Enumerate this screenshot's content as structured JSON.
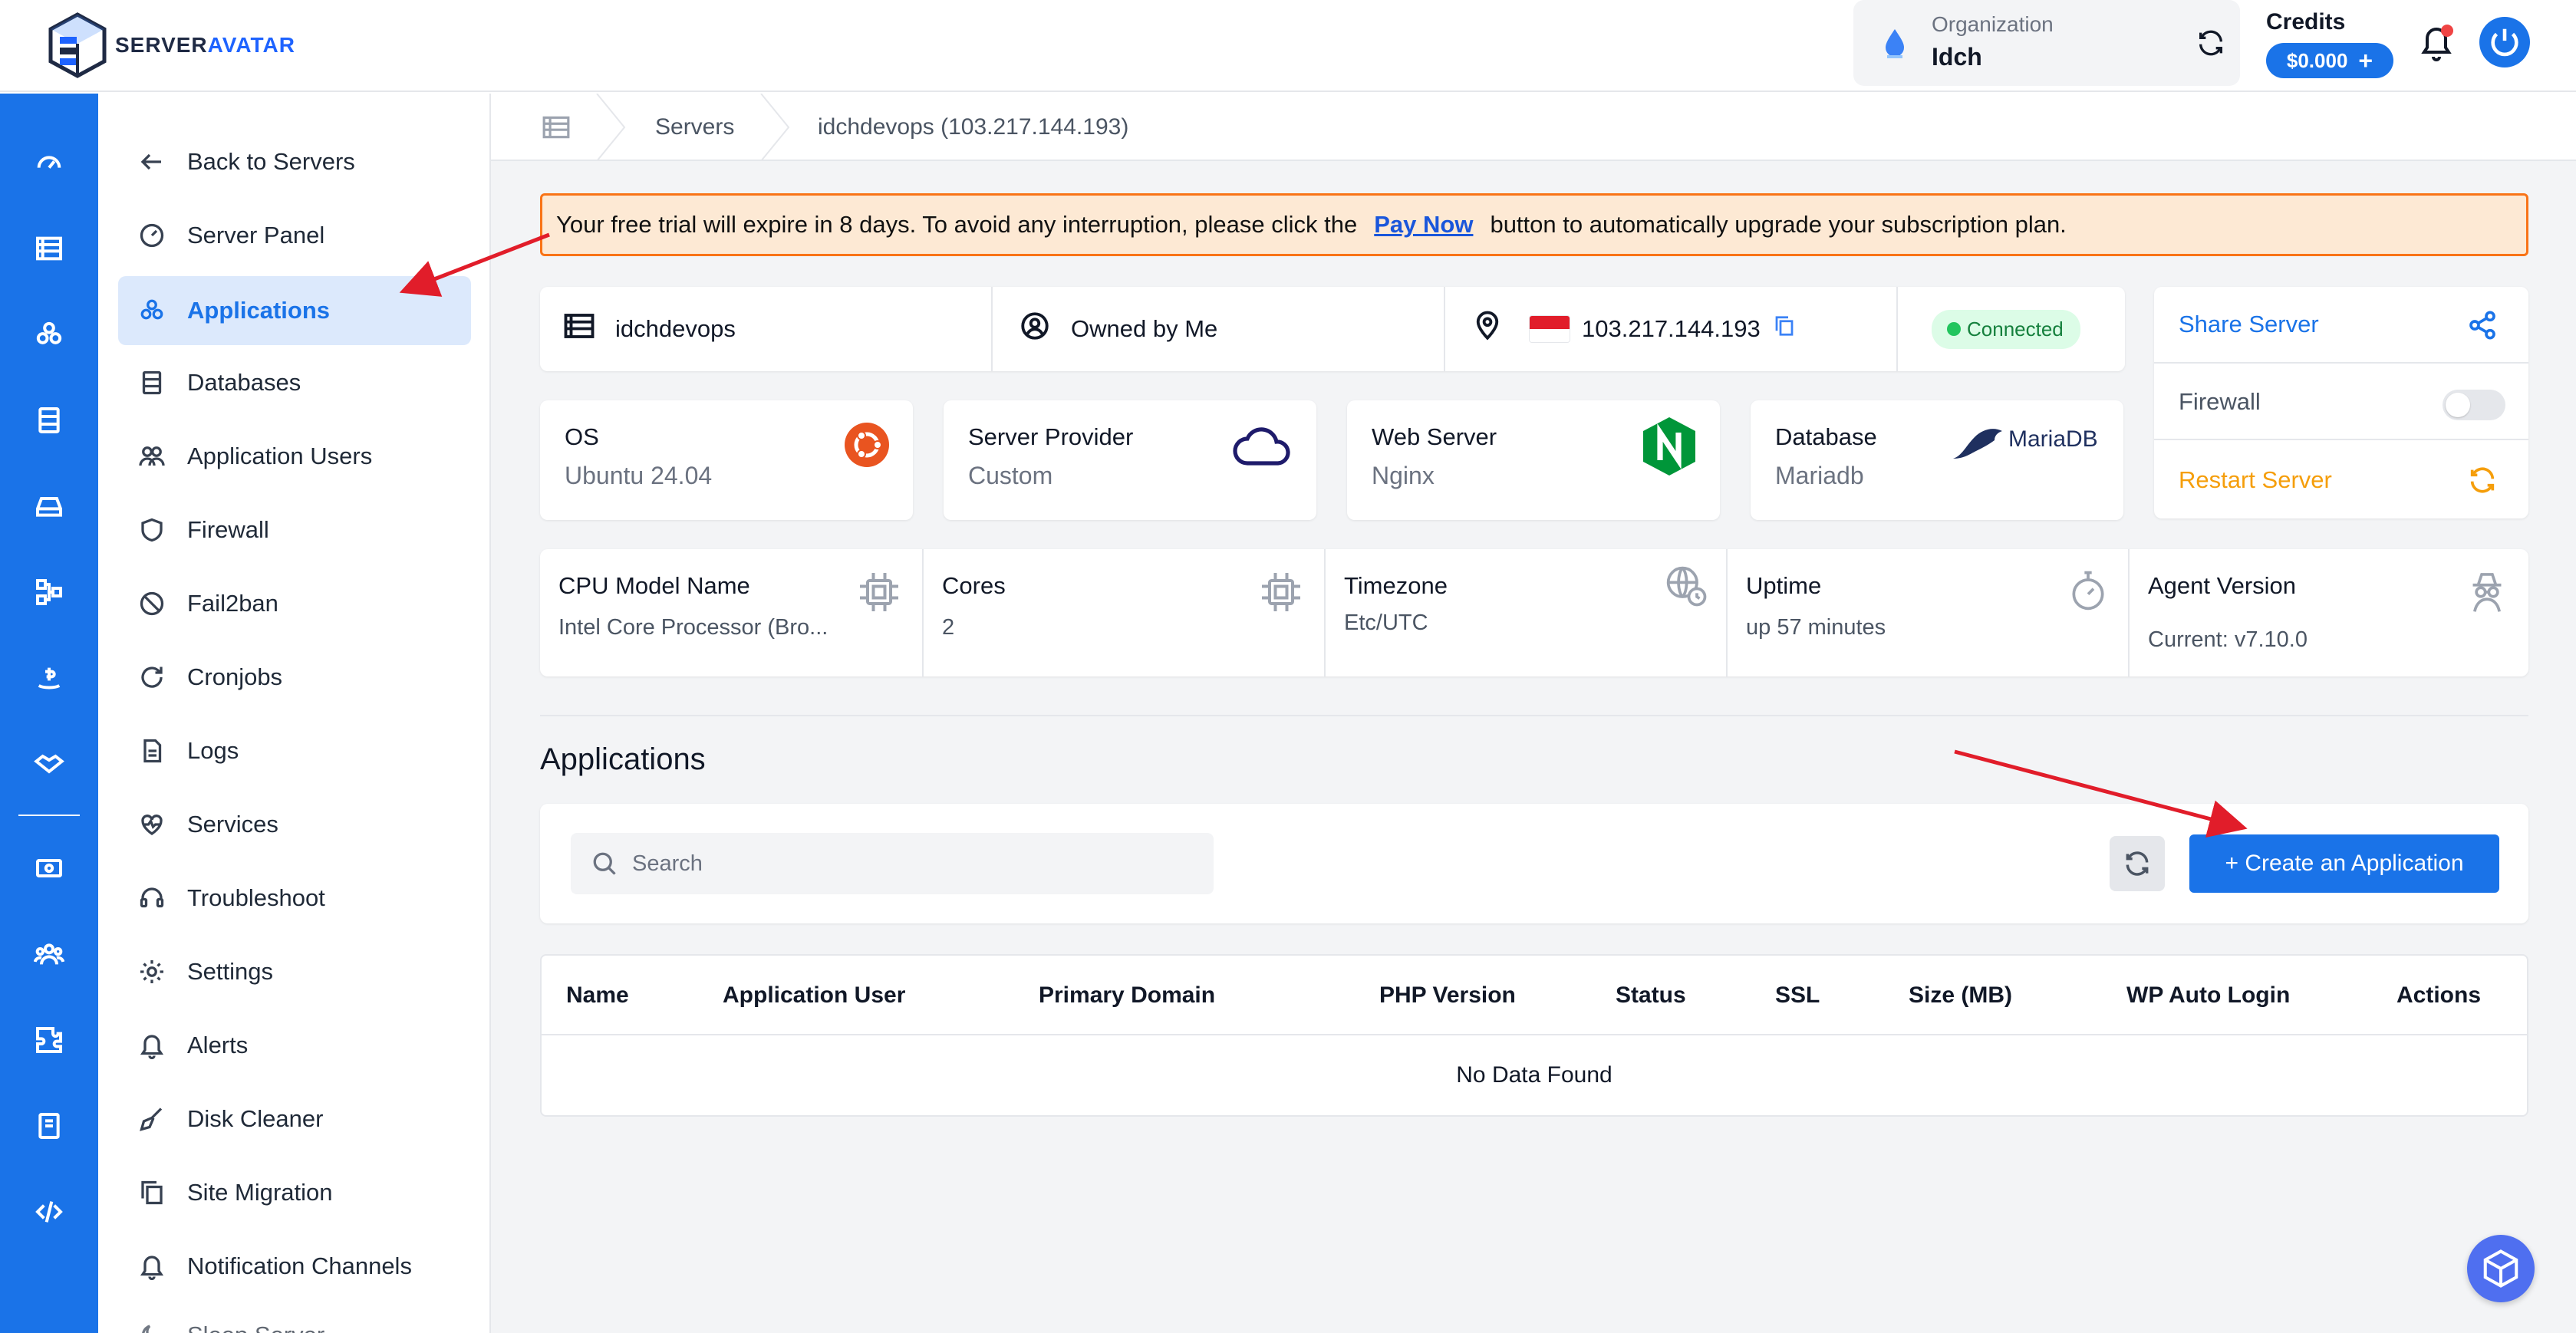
{
  "brand": {
    "part1": "SERVER",
    "part2": "AVATAR"
  },
  "header": {
    "org_label": "Organization",
    "org_value": "Idch",
    "credits_label": "Credits",
    "credits_value": "$0.000"
  },
  "rail_icons": [
    "dashboard-icon",
    "servers-icon",
    "applications-icon",
    "databases-icon",
    "storage-icon",
    "network-icon",
    "billing-icon",
    "handshake-icon",
    "money-icon",
    "team-icon",
    "integrations-icon",
    "docs-icon",
    "code-icon"
  ],
  "menu": {
    "items": [
      {
        "label": "Back to Servers",
        "icon": "arrow-left-icon"
      },
      {
        "label": "Server Panel",
        "icon": "gauge-icon"
      },
      {
        "label": "Applications",
        "icon": "applications-icon"
      },
      {
        "label": "Databases",
        "icon": "database-icon"
      },
      {
        "label": "Application Users",
        "icon": "users-icon"
      },
      {
        "label": "Firewall",
        "icon": "shield-icon"
      },
      {
        "label": "Fail2ban",
        "icon": "ban-icon"
      },
      {
        "label": "Cronjobs",
        "icon": "refresh-icon"
      },
      {
        "label": "Logs",
        "icon": "file-icon"
      },
      {
        "label": "Services",
        "icon": "heart-pulse-icon"
      },
      {
        "label": "Troubleshoot",
        "icon": "headset-icon"
      },
      {
        "label": "Settings",
        "icon": "gear-icon"
      },
      {
        "label": "Alerts",
        "icon": "bell-icon"
      },
      {
        "label": "Disk Cleaner",
        "icon": "broom-icon"
      },
      {
        "label": "Site Migration",
        "icon": "copy-icon"
      },
      {
        "label": "Notification Channels",
        "icon": "bell-icon"
      },
      {
        "label": "Sleep Server",
        "icon": "moon-icon"
      }
    ]
  },
  "breadcrumb": {
    "servers": "Servers",
    "current": "idchdevops (103.217.144.193)"
  },
  "alert": {
    "before": "Your free trial will expire in 8 days. To avoid any interruption, please click the",
    "link": "Pay Now",
    "after": "button to automatically upgrade your subscription plan."
  },
  "server": {
    "name": "idchdevops",
    "owner": "Owned by Me",
    "ip": "103.217.144.193",
    "status": "Connected"
  },
  "actions": {
    "share": "Share Server",
    "firewall": "Firewall",
    "restart": "Restart Server"
  },
  "stack": [
    {
      "label": "OS",
      "value": "Ubuntu 24.04"
    },
    {
      "label": "Server Provider",
      "value": "Custom"
    },
    {
      "label": "Web Server",
      "value": "Nginx"
    },
    {
      "label": "Database",
      "value": "Mariadb",
      "logo_text": "MariaDB"
    }
  ],
  "specs": [
    {
      "label": "CPU Model Name",
      "value": "Intel Core Processor (Bro..."
    },
    {
      "label": "Cores",
      "value": "2"
    },
    {
      "label": "Timezone",
      "value": "Etc/UTC"
    },
    {
      "label": "Uptime",
      "value": "up 57 minutes"
    },
    {
      "label": "Agent Version",
      "value": "Current: v7.10.0"
    }
  ],
  "applications": {
    "title": "Applications",
    "search_placeholder": "Search",
    "create_label": "+ Create an Application",
    "columns": [
      "Name",
      "Application User",
      "Primary Domain",
      "PHP Version",
      "Status",
      "SSL",
      "Size (MB)",
      "WP Auto Login",
      "Actions"
    ],
    "empty": "No Data Found"
  },
  "colors": {
    "accent": "#1a73e8",
    "warning": "#f59e0b",
    "success": "#22c55e",
    "annotation": "#e11d2a"
  }
}
